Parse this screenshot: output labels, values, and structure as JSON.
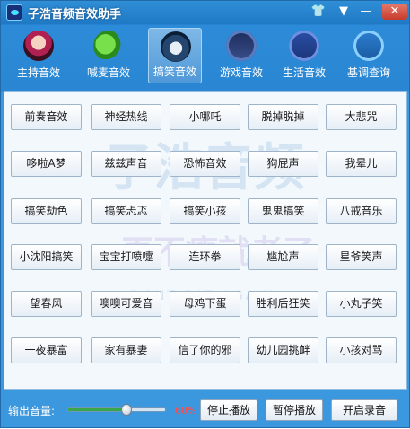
{
  "window": {
    "title": "子浩音频音效助手"
  },
  "title_icons": [
    "shirt-icon",
    "menu-icon",
    "minimize-icon",
    "close-icon"
  ],
  "tabs": [
    {
      "label": "主持音效",
      "icon": "host-icon"
    },
    {
      "label": "喊麦音效",
      "icon": "microphone-icon"
    },
    {
      "label": "搞笑音效",
      "icon": "funny-icon",
      "active": true
    },
    {
      "label": "游戏音效",
      "icon": "game-icon"
    },
    {
      "label": "生活音效",
      "icon": "life-icon"
    },
    {
      "label": "基调查询",
      "icon": "tone-icon"
    }
  ],
  "sounds": [
    [
      "前奏音效",
      "神经热线",
      "小哪吒",
      "脱掉脱掉",
      "大悲咒"
    ],
    [
      "哆啦A梦",
      "兹兹声音",
      "恐怖音效",
      "狗屁声",
      "我晕儿"
    ],
    [
      "搞笑劫色",
      "搞笑忐忑",
      "搞笑小孩",
      "鬼鬼搞笑",
      "八戒音乐"
    ],
    [
      "小沈阳搞笑",
      "宝宝打喷嚏",
      "连环拳",
      "尴尬声",
      "星爷笑声"
    ],
    [
      "望春风",
      "噢噢可爱音",
      "母鸡下蛋",
      "胜利后狂笑",
      "小丸子笑"
    ],
    [
      "一夜暴富",
      "家有暴妻",
      "信了你的邪",
      "幼儿园挑衅",
      "小孩对骂"
    ]
  ],
  "bottom": {
    "volume_label": "输出音量:",
    "volume_percent_text": "60%",
    "volume_level": 0.6,
    "stop_label": "停止播放",
    "pause_label": "暂停播放",
    "record_label": "开启录音"
  }
}
